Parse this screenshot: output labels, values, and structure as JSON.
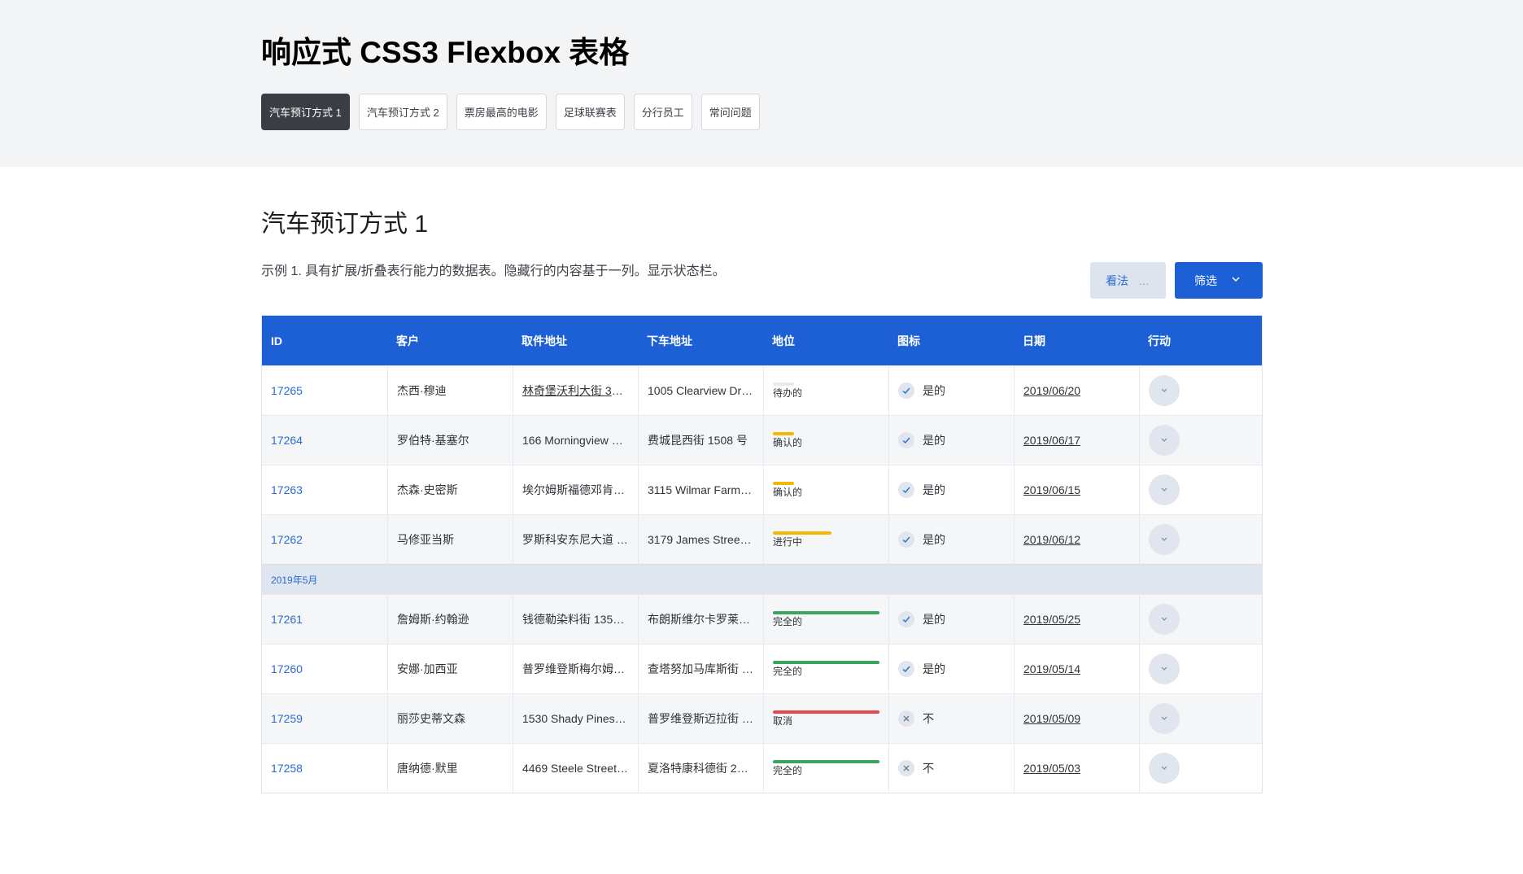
{
  "page_title": "响应式 CSS3 Flexbox 表格",
  "tabs": [
    {
      "label": "汽车预订方式 1",
      "active": true
    },
    {
      "label": "汽车预订方式 2",
      "active": false
    },
    {
      "label": "票房最高的电影",
      "active": false
    },
    {
      "label": "足球联赛表",
      "active": false
    },
    {
      "label": "分行员工",
      "active": false
    },
    {
      "label": "常问问题",
      "active": false
    }
  ],
  "section": {
    "title": "汽车预订方式 1",
    "description": "示例 1. 具有扩展/折叠表行能力的数据表。隐藏行的内容基于一列。显示状态栏。"
  },
  "buttons": {
    "view_label": "看法",
    "view_more": "…",
    "filter_label": "筛选"
  },
  "colors": {
    "primary": "#1d60d6",
    "pending": "#e6e9ee",
    "confirmed": "#f5b800",
    "complete": "#3aa55d",
    "cancelled": "#e5484d"
  },
  "table": {
    "headers": [
      "ID",
      "客户",
      "取件地址",
      "下车地址",
      "地位",
      "图标",
      "日期",
      "行动"
    ],
    "group_label": "2019年5月",
    "rows": [
      {
        "id": "17265",
        "customer": "杰西·穆迪",
        "pickup": "林奇堡沃利大街 37…",
        "pickup_link": true,
        "dropoff": "1005 Clearview Driv…",
        "status": "待办的",
        "status_type": "pending",
        "progress": 0.2,
        "icon_ok": true,
        "icon_label": "是的",
        "date": "2019/06/20"
      },
      {
        "id": "17264",
        "customer": "罗伯特·基塞尔",
        "pickup": "166 Morningview L…",
        "pickup_link": false,
        "dropoff": "费城昆西街 1508 号",
        "status": "确认的",
        "status_type": "confirmed",
        "progress": 0.2,
        "icon_ok": true,
        "icon_label": "是的",
        "date": "2019/06/17"
      },
      {
        "id": "17263",
        "customer": "杰森·史密斯",
        "pickup": "埃尔姆斯福德邓肯…",
        "pickup_link": false,
        "dropoff": "3115 Wilmar Farm …",
        "status": "确认的",
        "status_type": "confirmed",
        "progress": 0.2,
        "icon_ok": true,
        "icon_label": "是的",
        "date": "2019/06/15"
      },
      {
        "id": "17262",
        "customer": "马修亚当斯",
        "pickup": "罗斯科安东尼大道 …",
        "pickup_link": false,
        "dropoff": "3179 James Street,…",
        "status": "进行中",
        "status_type": "confirmed",
        "progress": 0.55,
        "icon_ok": true,
        "icon_label": "是的",
        "date": "2019/06/12"
      },
      {
        "id": "17261",
        "customer": "詹姆斯·约翰逊",
        "pickup": "钱德勒染料街 1354 …",
        "pickup_link": false,
        "dropoff": "布朗斯维尔卡罗莱…",
        "status": "完全的",
        "status_type": "complete",
        "progress": 1,
        "icon_ok": true,
        "icon_label": "是的",
        "date": "2019/05/25"
      },
      {
        "id": "17260",
        "customer": "安娜·加西亚",
        "pickup": "普罗维登斯梅尔姆…",
        "pickup_link": false,
        "dropoff": "查塔努加马库斯街 …",
        "status": "完全的",
        "status_type": "complete",
        "progress": 1,
        "icon_ok": true,
        "icon_label": "是的",
        "date": "2019/05/14"
      },
      {
        "id": "17259",
        "customer": "丽莎史蒂文森",
        "pickup": "1530 Shady Pines …",
        "pickup_link": false,
        "dropoff": "普罗维登斯迈拉街 …",
        "status": "取消",
        "status_type": "cancelled",
        "progress": 1,
        "icon_ok": false,
        "icon_label": "不",
        "date": "2019/05/09"
      },
      {
        "id": "17258",
        "customer": "唐纳德·默里",
        "pickup": "4469 Steele Street, …",
        "pickup_link": false,
        "dropoff": "夏洛特康科德街 23…",
        "status": "完全的",
        "status_type": "complete",
        "progress": 1,
        "icon_ok": false,
        "icon_label": "不",
        "date": "2019/05/03"
      }
    ]
  }
}
